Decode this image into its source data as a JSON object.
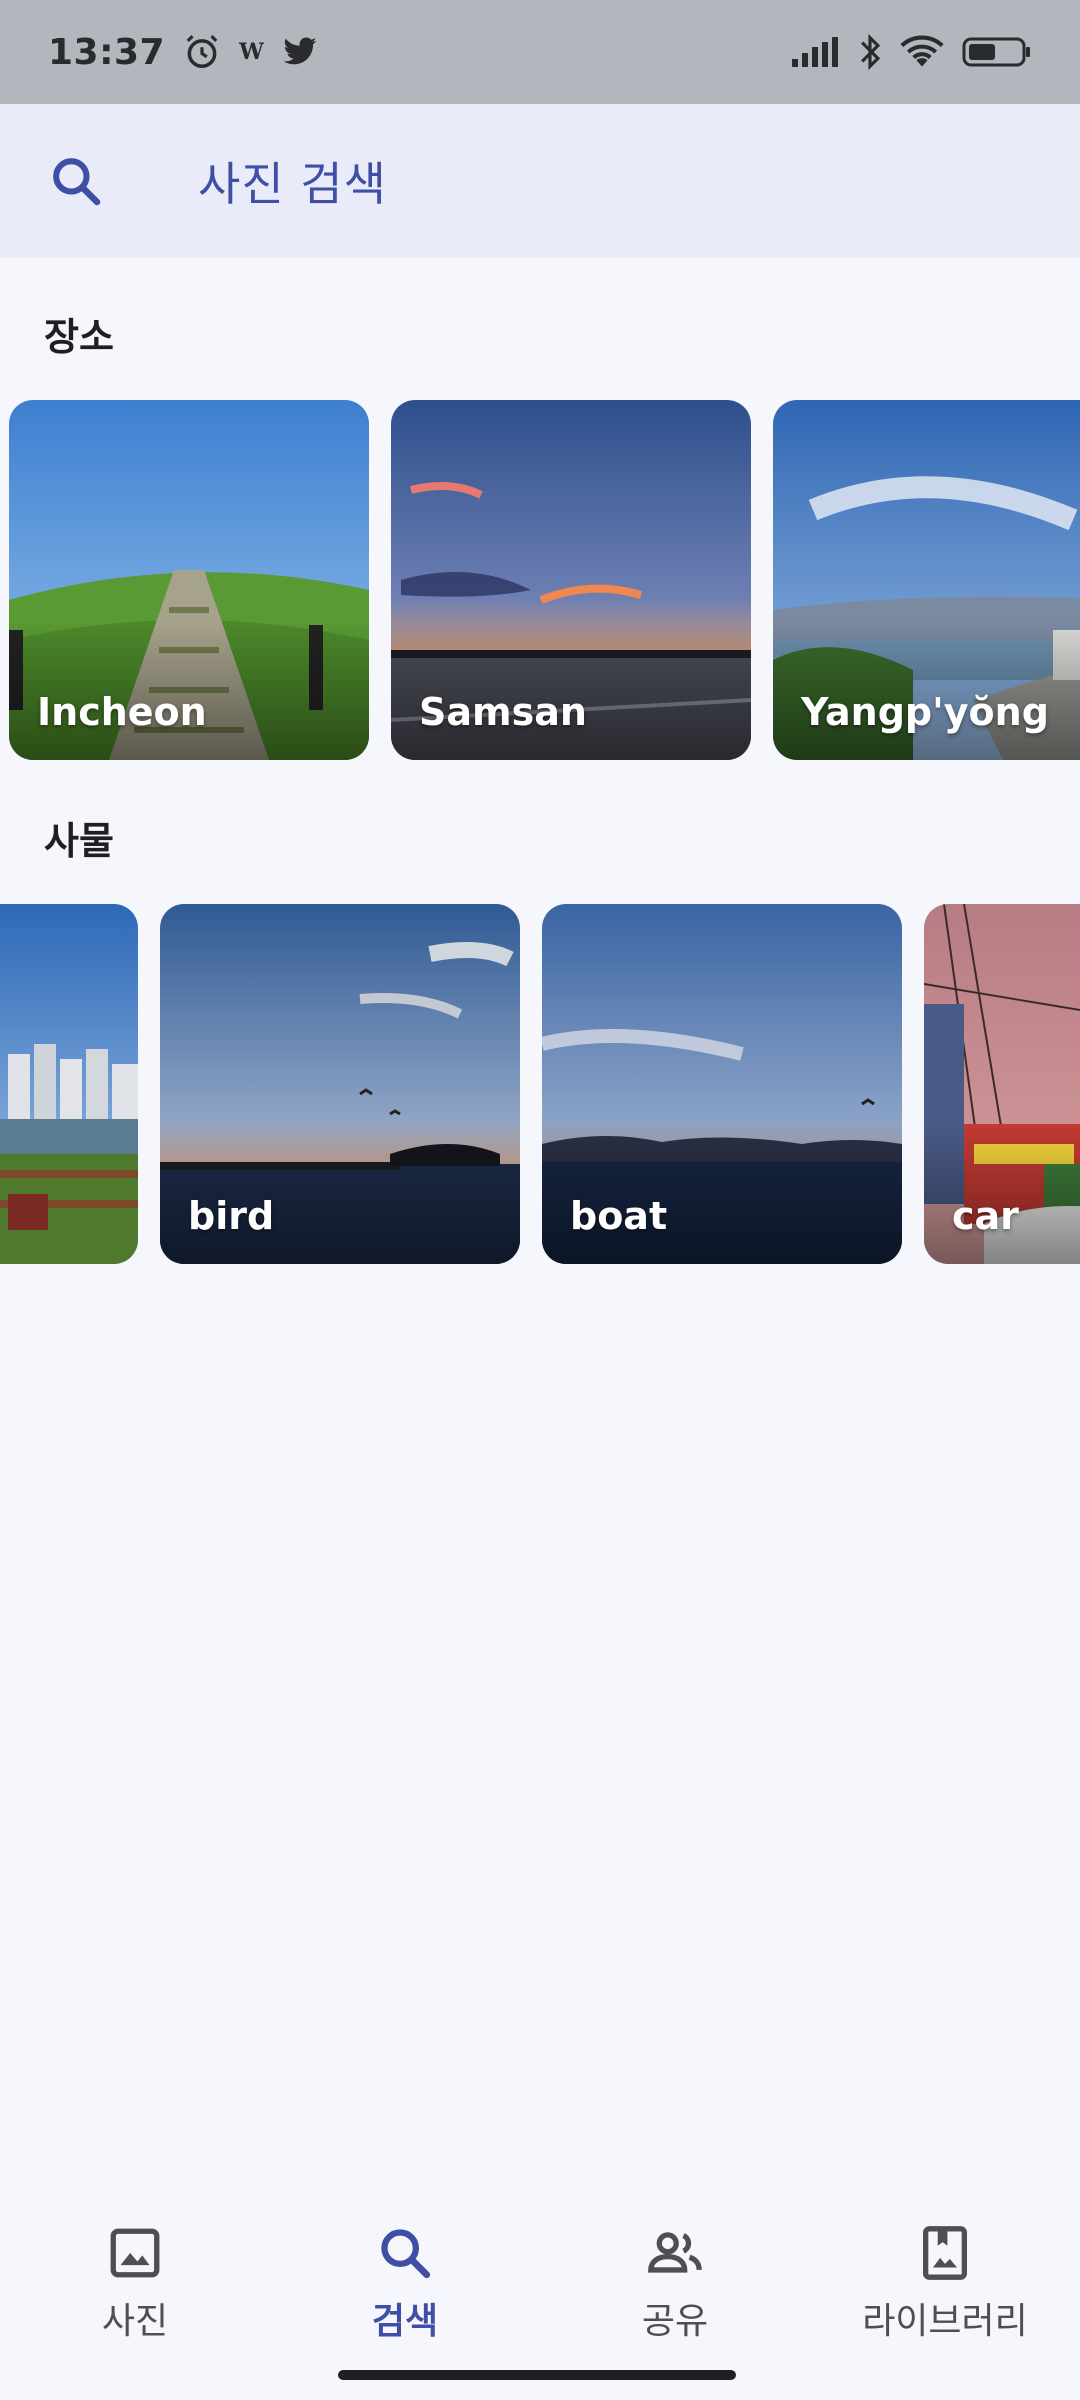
{
  "status_bar": {
    "time": "13:37",
    "icons_left": [
      "alarm-icon",
      "w-app-icon",
      "twitter-icon"
    ],
    "w_app_glyph": "W",
    "icons_right": [
      "signal-icon",
      "bluetooth-icon",
      "wifi-icon",
      "battery-icon"
    ]
  },
  "search": {
    "placeholder": "사진 검색",
    "icon": "search-icon",
    "accent_color": "#3f4fa6"
  },
  "places": {
    "title": "장소",
    "items": [
      {
        "label": "Incheon"
      },
      {
        "label": "Samsan"
      },
      {
        "label": "Yangp'yŏng"
      }
    ]
  },
  "things": {
    "title": "사물",
    "items": [
      {
        "label": ""
      },
      {
        "label": "bird"
      },
      {
        "label": "boat"
      },
      {
        "label": "car"
      }
    ]
  },
  "bottom_nav": {
    "items": [
      {
        "label": "사진",
        "icon": "photo-icon",
        "active": false
      },
      {
        "label": "검색",
        "icon": "search-icon",
        "active": true
      },
      {
        "label": "공유",
        "icon": "people-icon",
        "active": false
      },
      {
        "label": "라이브러리",
        "icon": "library-icon",
        "active": false
      }
    ]
  }
}
